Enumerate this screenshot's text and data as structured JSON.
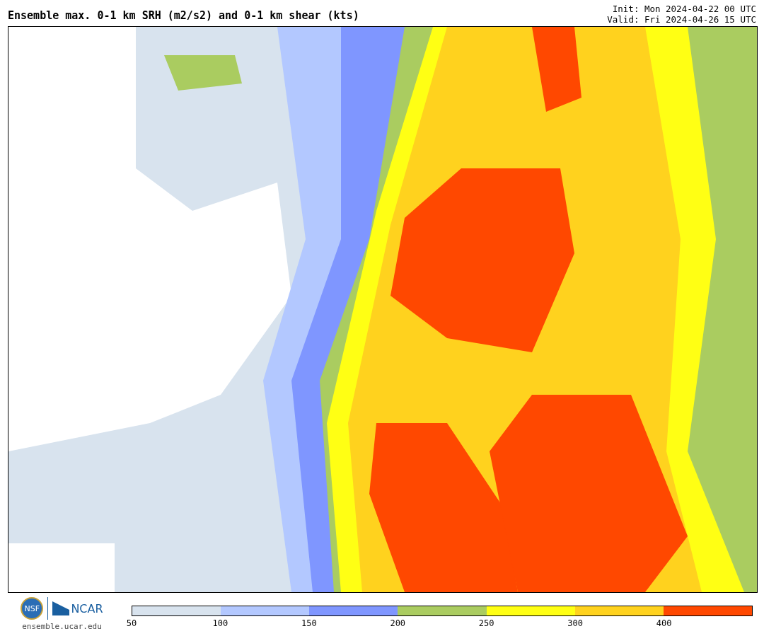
{
  "header": {
    "title": "Ensemble max. 0-1 km SRH (m2/s2) and 0-1 km shear (kts)",
    "init": "Init: Mon 2024-04-22 00 UTC",
    "valid": "Valid: Fri 2024-04-26 15 UTC"
  },
  "footer": {
    "nsf": "NSF",
    "ncar": "NCAR",
    "site": "ensemble.ucar.edu"
  },
  "legend": [
    {
      "color": "#d8e3ee",
      "label": "50"
    },
    {
      "color": "#b3c8ff",
      "label": "100"
    },
    {
      "color": "#7f96ff",
      "label": "150"
    },
    {
      "color": "#aacc60",
      "label": "200"
    },
    {
      "color": "#ffff14",
      "label": "250"
    },
    {
      "color": "#ffd21e",
      "label": "300"
    },
    {
      "color": "#ff4800",
      "label": "400"
    }
  ]
}
